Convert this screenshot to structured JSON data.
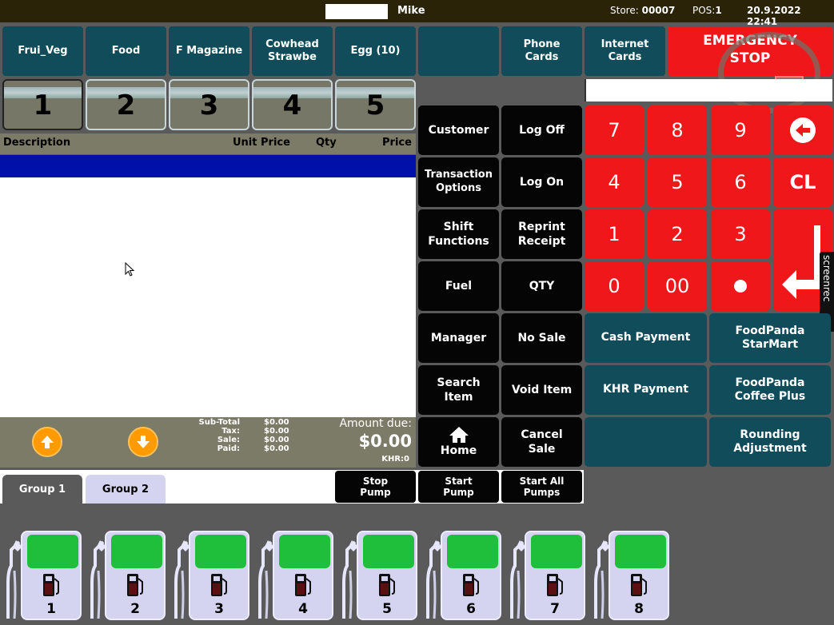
{
  "topbar": {
    "user": "Mike",
    "store_label": "Store:",
    "store_value": "00007",
    "pos_label": "POS:",
    "pos_value": "1",
    "datetime": "20.9.2022 22:41"
  },
  "categories": [
    {
      "label": "Frui_Veg"
    },
    {
      "label": "Food"
    },
    {
      "label": "F Magazine"
    },
    {
      "label": "Cowhead\nStrawbe"
    },
    {
      "label": "Egg (10)"
    },
    {
      "label": ""
    },
    {
      "label": "Phone\nCards"
    },
    {
      "label": "Internet\nCards"
    }
  ],
  "emergency": {
    "line1": "EMERGENCY",
    "line2": "STOP"
  },
  "transaction_tabs": [
    "1",
    "2",
    "3",
    "4",
    "5"
  ],
  "list_header": {
    "description": "Description",
    "unit_price": "Unit Price",
    "qty": "Qty",
    "price": "Price"
  },
  "totals": {
    "labels": [
      "Sub-Total",
      "Tax:",
      "Sale:",
      "Paid:"
    ],
    "values": [
      "$0.00",
      "$0.00",
      "$0.00",
      "$0.00"
    ],
    "amount_due_label": "Amount due:",
    "amount_due_value": "$0.00",
    "khr": "KHR:0"
  },
  "function_buttons": {
    "customer": "Customer",
    "log_off": "Log Off",
    "transaction_options": "Transaction\nOptions",
    "log_on": "Log On",
    "shift_functions": "Shift\nFunctions",
    "reprint_receipt": "Reprint\nReceipt",
    "fuel": "Fuel",
    "qty": "QTY",
    "manager": "Manager",
    "no_sale": "No Sale",
    "search_item": "Search\nItem",
    "void_item": "Void Item",
    "home": "Home",
    "cancel_sale": "Cancel\nSale"
  },
  "keypad": {
    "k7": "7",
    "k8": "8",
    "k9": "9",
    "k4": "4",
    "k5": "5",
    "k6": "6",
    "clear": "CL",
    "k1": "1",
    "k2": "2",
    "k3": "3",
    "k0": "0",
    "k00": "00"
  },
  "payment": {
    "cash": "Cash Payment",
    "foodpanda_starmart": "FoodPanda\nStarMart",
    "khr": "KHR Payment",
    "foodpanda_coffee": "FoodPanda\nCoffee Plus",
    "rounding": "Rounding\nAdjustment"
  },
  "groups": [
    "Group 1",
    "Group 2"
  ],
  "pump_controls": {
    "stop": "Stop\nPump",
    "start": "Start\nPump",
    "start_all": "Start All\nPumps"
  },
  "pumps": [
    "1",
    "2",
    "3",
    "4",
    "5",
    "6",
    "7",
    "8"
  ],
  "watermark": "screenrec",
  "colors": {
    "red": "#f0171a",
    "teal": "#114c5a",
    "blue_row": "#0010a8",
    "pump_screen": "#1fbf3c"
  }
}
